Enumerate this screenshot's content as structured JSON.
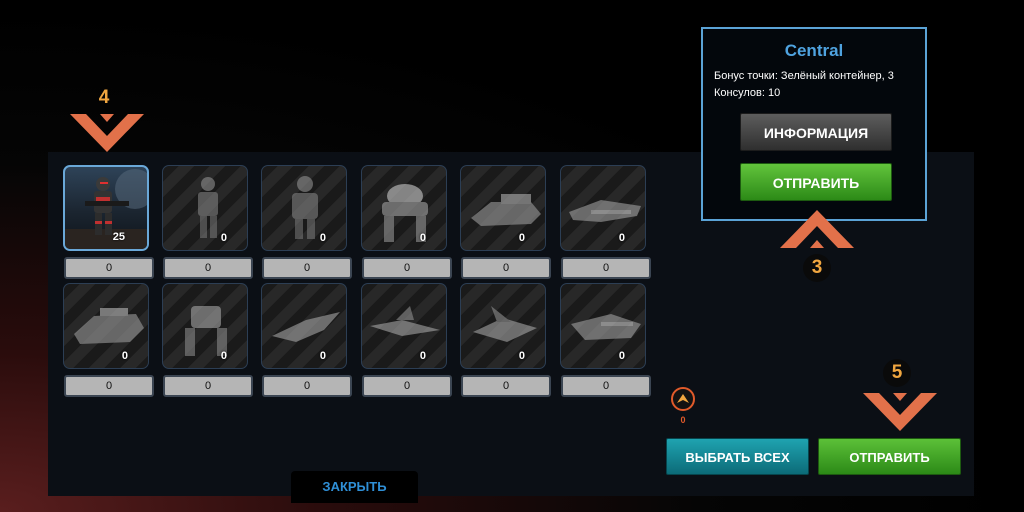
{
  "units": [
    {
      "name": "trooper",
      "count": "25",
      "qty": "0",
      "selected": true
    },
    {
      "name": "soldier",
      "count": "0",
      "qty": "0"
    },
    {
      "name": "heavy",
      "count": "0",
      "qty": "0"
    },
    {
      "name": "mech",
      "count": "0",
      "qty": "0"
    },
    {
      "name": "hover-tank",
      "count": "0",
      "qty": "0"
    },
    {
      "name": "gunship",
      "count": "0",
      "qty": "0"
    },
    {
      "name": "tank",
      "count": "0",
      "qty": "0"
    },
    {
      "name": "walker",
      "count": "0",
      "qty": "0"
    },
    {
      "name": "fighter",
      "count": "0",
      "qty": "0"
    },
    {
      "name": "interceptor",
      "count": "0",
      "qty": "0"
    },
    {
      "name": "bomber",
      "count": "0",
      "qty": "0"
    },
    {
      "name": "cruiser",
      "count": "0",
      "qty": "0"
    }
  ],
  "popup": {
    "title": "Central",
    "description": "Бонус точки: Зелёный контейнер, 3 Консулов: 10",
    "info_label": "ИНФОРМАЦИЯ",
    "send_label": "ОТПРАВИТЬ"
  },
  "consul": {
    "icon": "consul-icon",
    "count": "0"
  },
  "buttons": {
    "select_all": "ВЫБРАТЬ ВСЕХ",
    "send": "ОТПРАВИТЬ",
    "close": "ЗАКРЫТЬ"
  },
  "tutorial_markers": {
    "m3": "3",
    "m4": "4",
    "m5": "5"
  },
  "colors": {
    "accent": "#4fa3e0",
    "marker": "#e2714a",
    "marker_number": "#f0a640",
    "send": "#3fa625",
    "select_all": "#108c99"
  }
}
